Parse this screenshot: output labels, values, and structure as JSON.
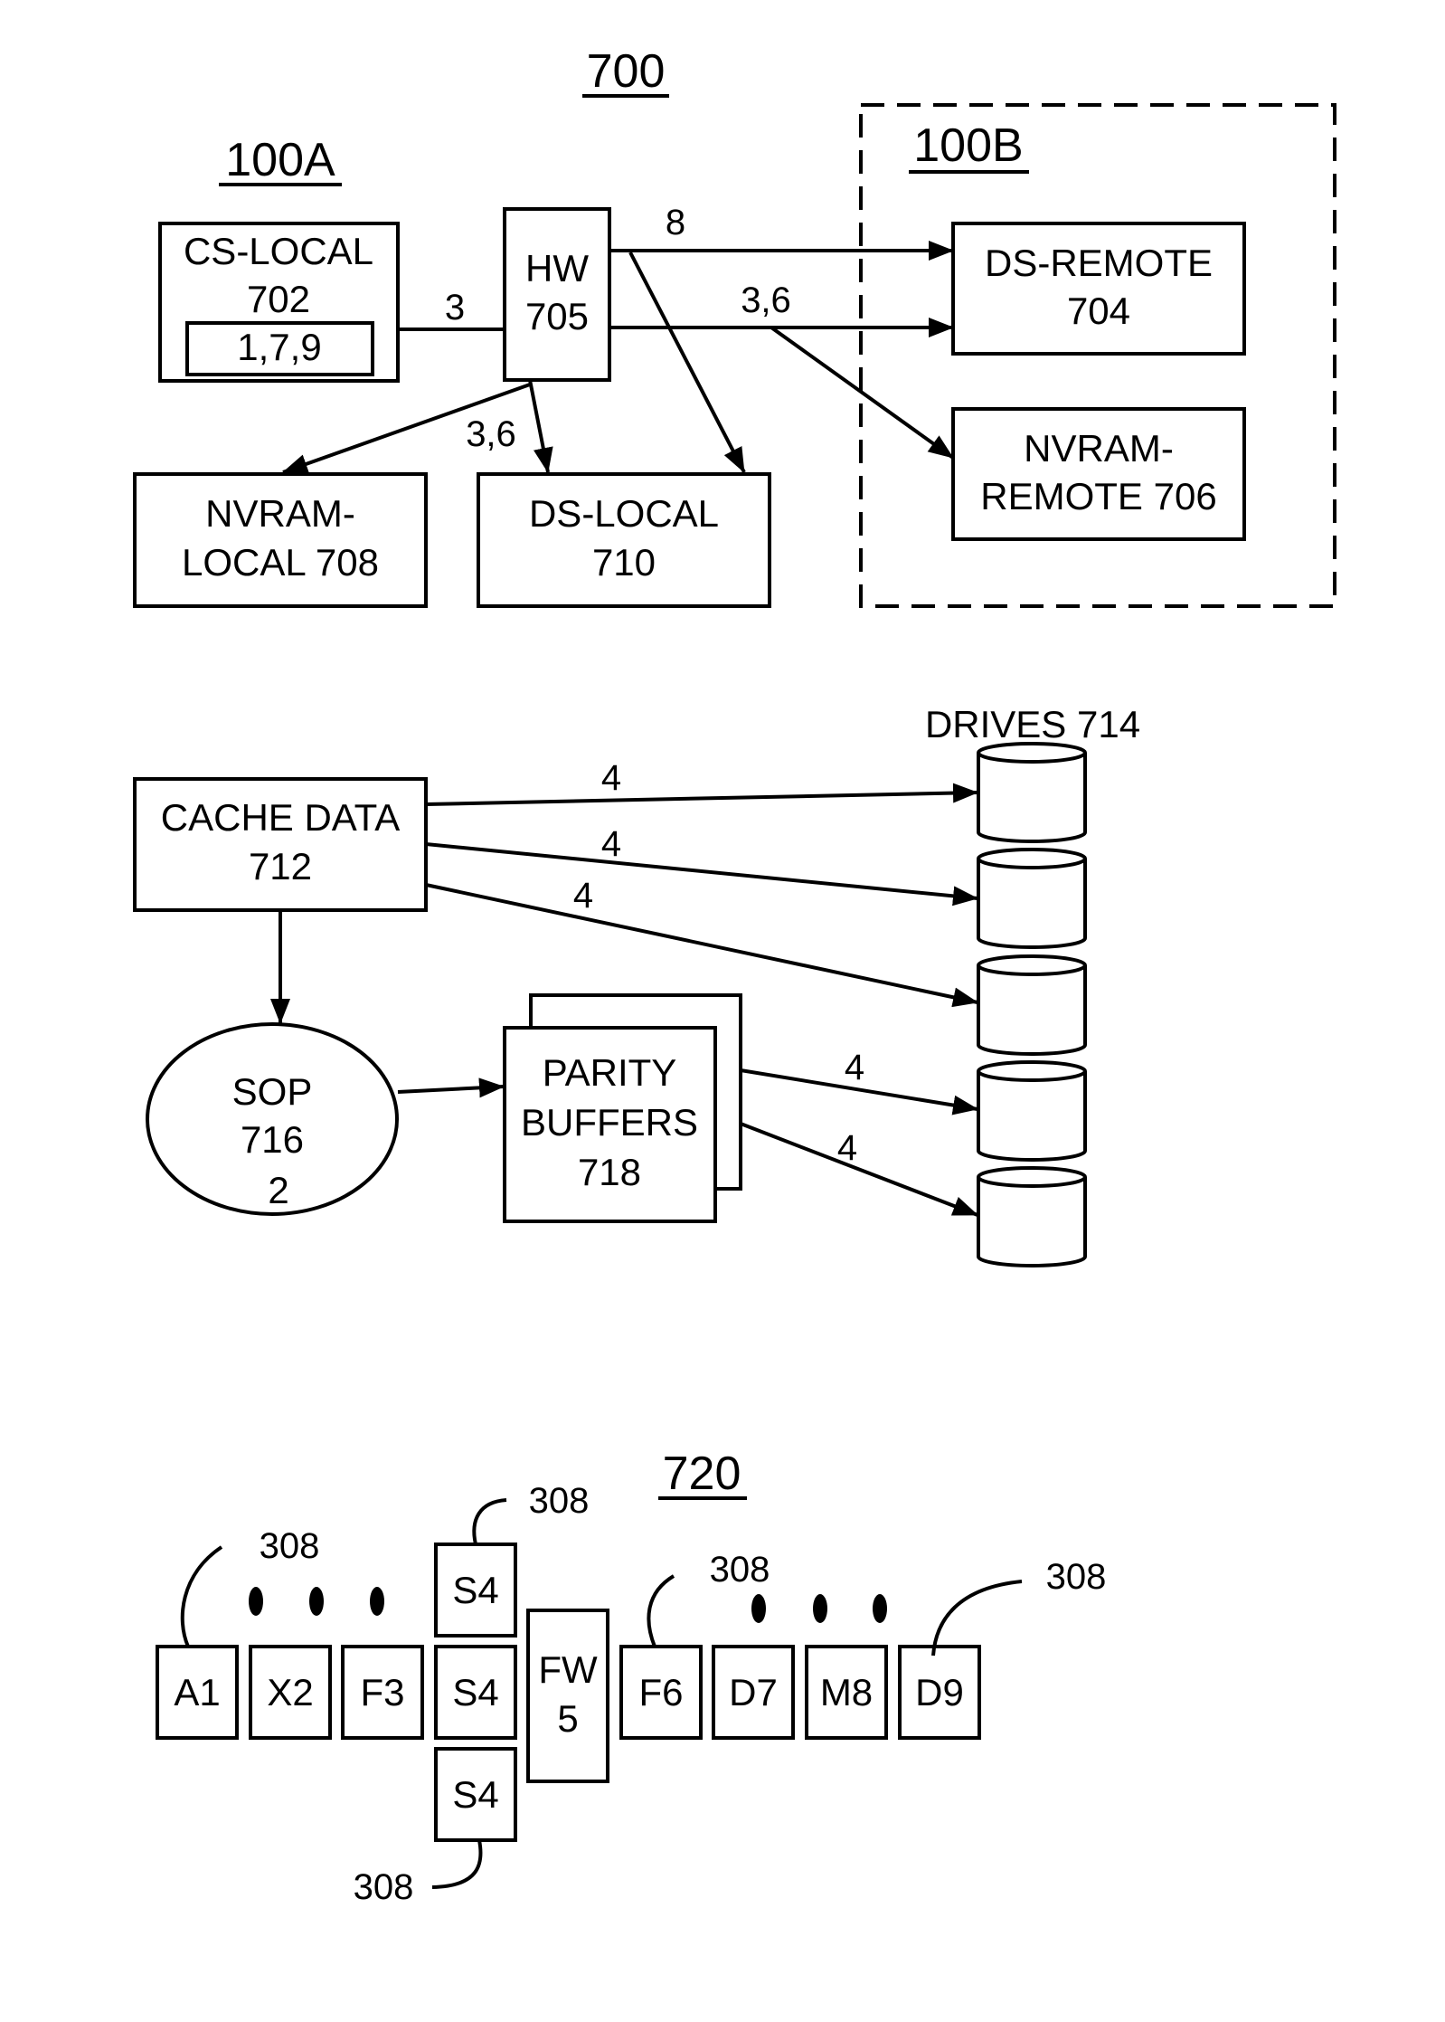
{
  "figure_number": "700",
  "systems": {
    "local": {
      "label": "100A"
    },
    "remote": {
      "label": "100B"
    }
  },
  "nodes": {
    "cs_local": {
      "line1": "CS-LOCAL",
      "line2": "702",
      "inner": "1,7,9"
    },
    "hw": {
      "line1": "HW",
      "line2": "705"
    },
    "ds_remote": {
      "line1": "DS-REMOTE",
      "line2": "704"
    },
    "nvram_remote": {
      "line1": "NVRAM-",
      "line2": "REMOTE 706"
    },
    "nvram_local": {
      "line1": "NVRAM-",
      "line2": "LOCAL 708"
    },
    "ds_local": {
      "line1": "DS-LOCAL",
      "line2": "710"
    },
    "cache_data": {
      "line1": "CACHE DATA",
      "line2": "712"
    },
    "drives": {
      "label": "DRIVES 714",
      "count": 5
    },
    "sop": {
      "line1": "SOP",
      "line2": "716",
      "line3": "2"
    },
    "parity": {
      "line1": "PARITY",
      "line2": "BUFFERS",
      "line3": "718"
    }
  },
  "edge_labels": {
    "cs_to_hw": "3",
    "hw_to_ds_remote_top": "8",
    "hw_to_ds_remote_bottom": "3,6",
    "hw_to_ds_local": "3,6",
    "cache_to_drive_1": "4",
    "cache_to_drive_2": "4",
    "cache_to_drive_3": "4",
    "parity_to_drive_4": "4",
    "parity_to_drive_5": "4"
  },
  "sequence": {
    "title": "720",
    "cells": [
      "A1",
      "X2",
      "F3",
      "S4",
      "F6",
      "D7",
      "M8",
      "D9"
    ],
    "s4_top": "S4",
    "s4_bottom": "S4",
    "fw": {
      "line1": "FW",
      "line2": "5"
    },
    "callouts": [
      "308",
      "308",
      "308",
      "308",
      "308"
    ]
  }
}
